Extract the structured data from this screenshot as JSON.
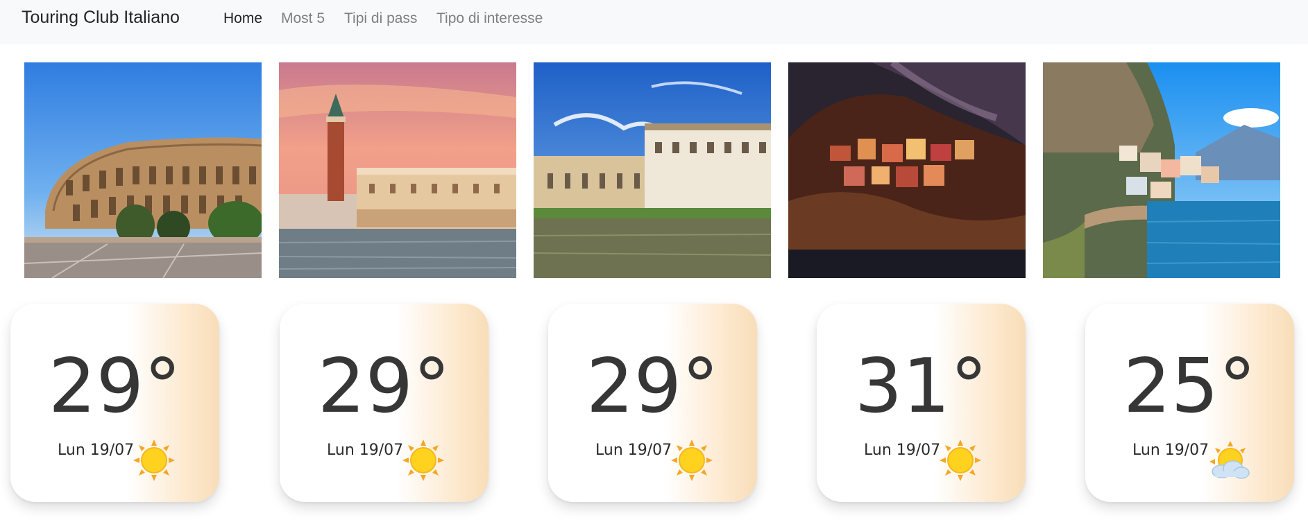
{
  "navbar": {
    "brand": "Touring Club Italiano",
    "links": [
      {
        "label": "Home",
        "active": true
      },
      {
        "label": "Most 5",
        "active": false
      },
      {
        "label": "Tipi di pass",
        "active": false
      },
      {
        "label": "Tipo di interesse",
        "active": false
      }
    ]
  },
  "photos": [
    {
      "subject": "colosseum-photo"
    },
    {
      "subject": "venice-photo"
    },
    {
      "subject": "florence-photo"
    },
    {
      "subject": "manarola-photo"
    },
    {
      "subject": "amalfi-photo"
    }
  ],
  "weather_cards": [
    {
      "temperature": "29°",
      "date": "Lun 19/07",
      "icon": "sun-icon"
    },
    {
      "temperature": "29°",
      "date": "Lun 19/07",
      "icon": "sun-icon"
    },
    {
      "temperature": "29°",
      "date": "Lun 19/07",
      "icon": "sun-icon"
    },
    {
      "temperature": "31°",
      "date": "Lun 19/07",
      "icon": "sun-icon"
    },
    {
      "temperature": "25°",
      "date": "Lun 19/07",
      "icon": "sun-behind-cloud-icon"
    }
  ],
  "colors": {
    "navbar_bg": "#f8f9fa",
    "card_gradient_end": "#f8ddb8",
    "sun_yellow": "#ffd21f",
    "sun_orange": "#f5a623"
  }
}
